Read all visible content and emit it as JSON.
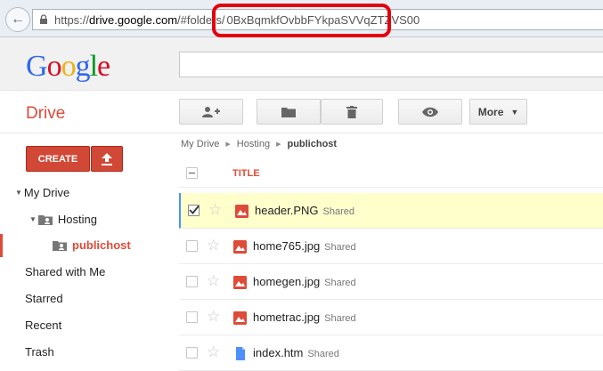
{
  "browser": {
    "url_scheme": "https://",
    "url_host": "drive.google.com",
    "url_path": "/#folders/",
    "url_id": "0BxBqmkfOvbbFYkpaSVVqZTZVS00"
  },
  "header": {
    "logo_letters": [
      "G",
      "o",
      "o",
      "g",
      "l",
      "e"
    ],
    "search_value": ""
  },
  "app": {
    "title": "Drive",
    "create_label": "CREATE",
    "more_label": "More"
  },
  "sidebar": {
    "my_drive": "My Drive",
    "hosting": "Hosting",
    "publichost": "publichost",
    "shared": "Shared with Me",
    "starred": "Starred",
    "recent": "Recent",
    "trash": "Trash"
  },
  "breadcrumb": [
    "My Drive",
    "Hosting",
    "publichost"
  ],
  "list": {
    "title_header": "TITLE",
    "files": [
      {
        "name": "header.PNG",
        "status": "Shared",
        "type": "image",
        "selected": true
      },
      {
        "name": "home765.jpg",
        "status": "Shared",
        "type": "image",
        "selected": false
      },
      {
        "name": "homegen.jpg",
        "status": "Shared",
        "type": "image",
        "selected": false
      },
      {
        "name": "hometrac.jpg",
        "status": "Shared",
        "type": "image",
        "selected": false
      },
      {
        "name": "index.htm",
        "status": "Shared",
        "type": "doc",
        "selected": false
      }
    ]
  },
  "colors": {
    "accent": "#dd4b39",
    "highlight_ring": "#e3000f",
    "selected_row": "#ffffcc"
  }
}
